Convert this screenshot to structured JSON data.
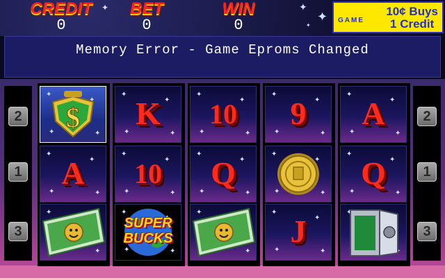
{
  "meters": {
    "credit": {
      "label": "CREDIT",
      "value": "0"
    },
    "bet": {
      "label": "BET",
      "value": "0"
    },
    "win": {
      "label": "WIN",
      "value": "0"
    }
  },
  "denomination": {
    "game_label": "GAME",
    "line1": "10¢ Buys",
    "line2": "1 Credit"
  },
  "message": "Memory Error - Game Eproms Changed",
  "paylines": {
    "left": [
      "2",
      "1",
      "3"
    ],
    "right": [
      "2",
      "1",
      "3"
    ]
  },
  "reels": [
    [
      {
        "symbol": "dollar-emblem",
        "text": ""
      },
      {
        "symbol": "letter",
        "text": "A"
      },
      {
        "symbol": "banknote",
        "text": ""
      }
    ],
    [
      {
        "symbol": "letter",
        "text": "K"
      },
      {
        "symbol": "letter",
        "text": "10"
      },
      {
        "symbol": "super-bucks-logo",
        "text": "SUPER BUCKS"
      }
    ],
    [
      {
        "symbol": "letter",
        "text": "10"
      },
      {
        "symbol": "letter",
        "text": "Q"
      },
      {
        "symbol": "banknote",
        "text": ""
      }
    ],
    [
      {
        "symbol": "letter",
        "text": "9"
      },
      {
        "symbol": "gold-coin",
        "text": ""
      },
      {
        "symbol": "letter",
        "text": "J"
      }
    ],
    [
      {
        "symbol": "letter",
        "text": "A"
      },
      {
        "symbol": "letter",
        "text": "Q"
      },
      {
        "symbol": "safe",
        "text": ""
      }
    ]
  ],
  "colors": {
    "meter_label": "#ff2020",
    "symbol_red": "#ff2a1a",
    "message_bg": "#1c1c64",
    "denom_bg": "#ffe800"
  }
}
